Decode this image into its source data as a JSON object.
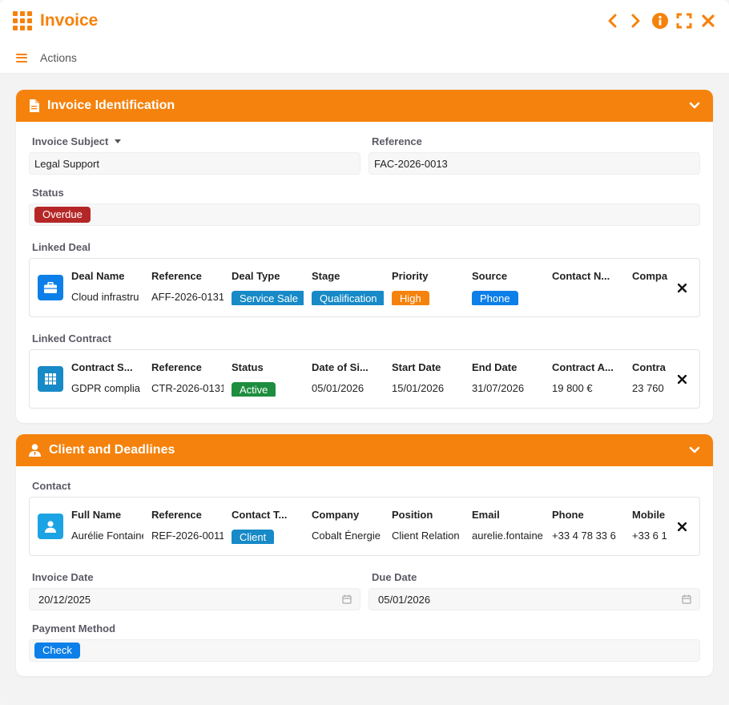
{
  "window": {
    "title": "Invoice",
    "actions_label": "Actions"
  },
  "colors": {
    "accent": "#f5820c",
    "overdue": "#b52727",
    "blue": "#0d7fe8",
    "teal": "#178ac7",
    "green": "#1e8e3e"
  },
  "identification": {
    "header": "Invoice Identification",
    "invoice_subject_label": "Invoice Subject",
    "invoice_subject_value": "Legal Support",
    "reference_label": "Reference",
    "reference_value": "FAC-2026-0013",
    "status_label": "Status",
    "status_value": "Overdue",
    "linked_deal_label": "Linked Deal",
    "linked_deal": {
      "icon": "briefcase-icon",
      "columns": [
        {
          "header": "Deal Name",
          "value": "Cloud infrastru"
        },
        {
          "header": "Reference",
          "value": "AFF-2026-0131"
        },
        {
          "header": "Deal Type",
          "value": "Service Sale",
          "badge": "teal"
        },
        {
          "header": "Stage",
          "value": "Qualification",
          "badge": "teal"
        },
        {
          "header": "Priority",
          "value": "High",
          "badge": "orange"
        },
        {
          "header": "Source",
          "value": "Phone",
          "badge": "blue"
        },
        {
          "header": "Contact N...",
          "value": ""
        },
        {
          "header": "Compa",
          "value": ""
        }
      ]
    },
    "linked_contract_label": "Linked Contract",
    "linked_contract": {
      "icon": "grid-icon",
      "columns": [
        {
          "header": "Contract S...",
          "value": "GDPR complia"
        },
        {
          "header": "Reference",
          "value": "CTR-2026-0131"
        },
        {
          "header": "Status",
          "value": "Active",
          "badge": "green"
        },
        {
          "header": "Date of Si...",
          "value": "05/01/2026"
        },
        {
          "header": "Start Date",
          "value": "15/01/2026"
        },
        {
          "header": "End Date",
          "value": "31/07/2026"
        },
        {
          "header": "Contract A...",
          "value": "19 800 €"
        },
        {
          "header": "Contra",
          "value": "23 760"
        }
      ]
    }
  },
  "client": {
    "header": "Client and Deadlines",
    "contact_label": "Contact",
    "contact": {
      "icon": "person-icon",
      "columns": [
        {
          "header": "Full Name",
          "value": "Aurélie Fontaine"
        },
        {
          "header": "Reference",
          "value": "REF-2026-0011"
        },
        {
          "header": "Contact T...",
          "value": "Client",
          "badge": "teal"
        },
        {
          "header": "Company",
          "value": "Cobalt Énergie"
        },
        {
          "header": "Position",
          "value": "Client Relation"
        },
        {
          "header": "Email",
          "value": "aurelie.fontaine"
        },
        {
          "header": "Phone",
          "value": "+33 4 78 33 6"
        },
        {
          "header": "Mobile",
          "value": "+33 6 1"
        }
      ]
    },
    "invoice_date_label": "Invoice Date",
    "invoice_date_value": "20/12/2025",
    "due_date_label": "Due Date",
    "due_date_value": "05/01/2026",
    "payment_method_label": "Payment Method",
    "payment_method_value": "Check"
  }
}
